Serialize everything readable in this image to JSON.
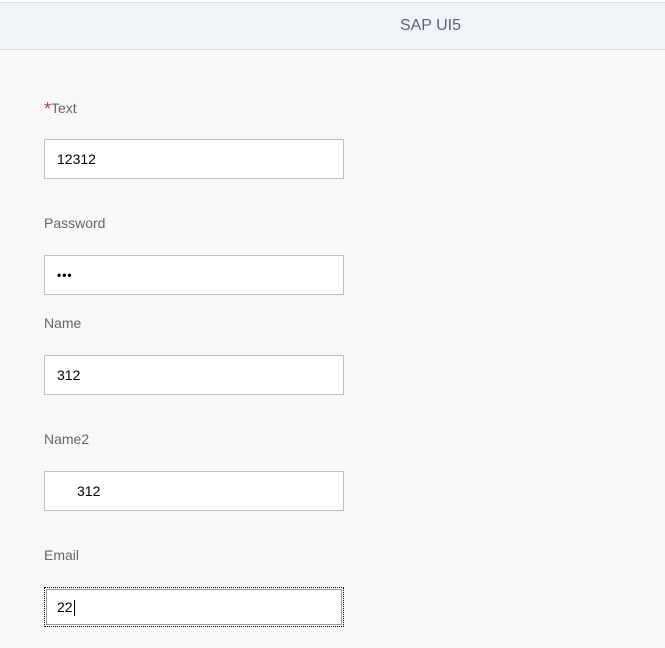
{
  "header": {
    "title": "SAP UI5"
  },
  "form": {
    "text_field": {
      "required_marker": "*",
      "label": "Text",
      "value": "12312"
    },
    "password_field": {
      "label": "Password",
      "value": "•••"
    },
    "name_field": {
      "label": "Name",
      "value": "312"
    },
    "name2_field": {
      "label": "Name2",
      "value": "312"
    },
    "email_field": {
      "label": "Email",
      "value": "22"
    }
  }
}
